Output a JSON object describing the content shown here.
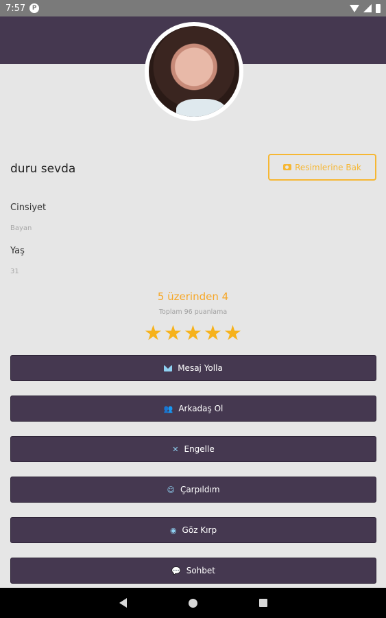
{
  "status_bar": {
    "time": "7:57",
    "p_badge": "P"
  },
  "profile": {
    "name": "duru sevda",
    "photos_button": "Resimlerine Bak",
    "fields": [
      {
        "label": "Cinsiyet",
        "value": "Bayan"
      },
      {
        "label": "Yaş",
        "value": "31"
      }
    ]
  },
  "rating": {
    "title": "5 üzerinden 4",
    "subtitle": "Toplam 96 puanlama",
    "stars": 5
  },
  "actions": [
    {
      "label": "Mesaj Yolla",
      "icon": "envelope-icon"
    },
    {
      "label": "Arkadaş Ol",
      "icon": "user-plus-icon"
    },
    {
      "label": "Engelle",
      "icon": "times-icon"
    },
    {
      "label": "Çarpıldım",
      "icon": "smile-icon"
    },
    {
      "label": "Göz Kırp",
      "icon": "eye-icon"
    },
    {
      "label": "Sohbet",
      "icon": "chat-icon"
    }
  ],
  "colors": {
    "primary": "#453850",
    "accent": "#f6b733",
    "icon": "#8fd1f2",
    "background": "#e6e6e6"
  }
}
